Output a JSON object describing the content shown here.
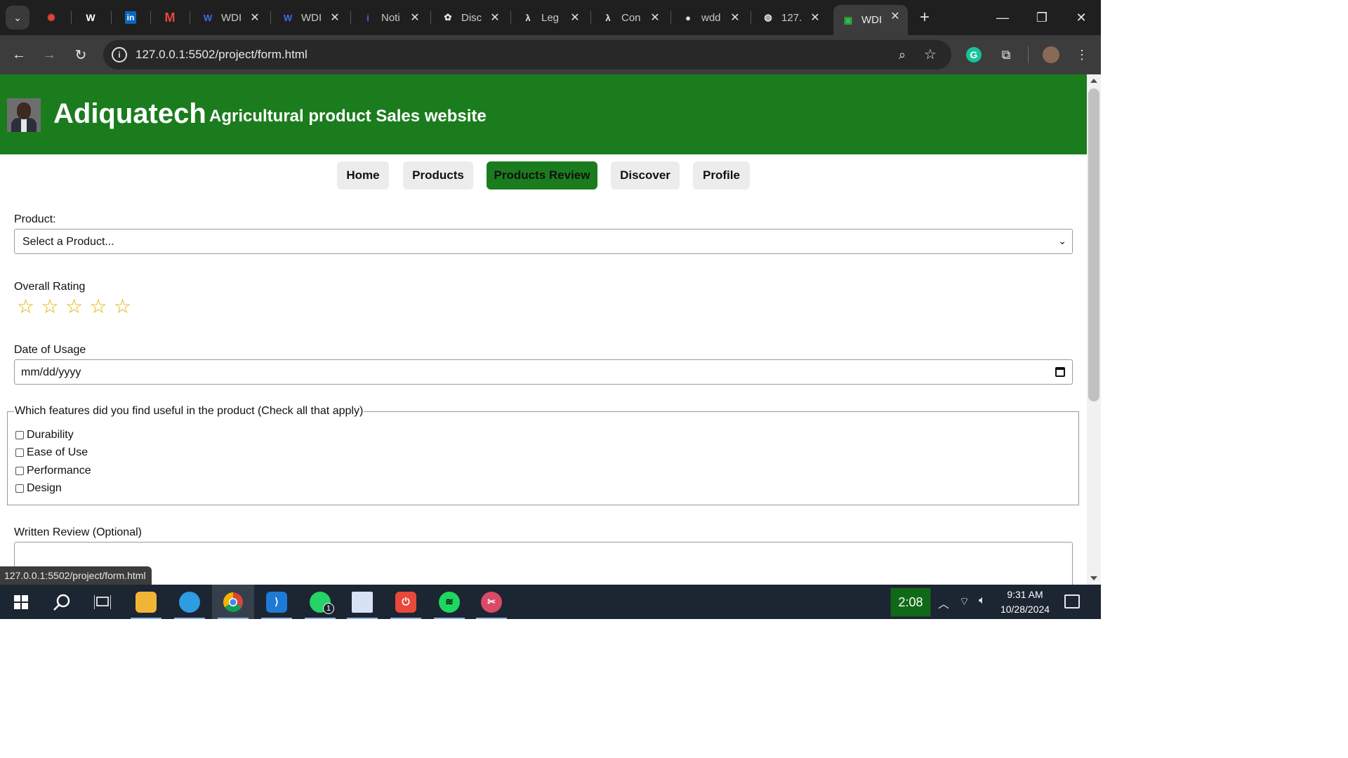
{
  "browser": {
    "tabs": [
      {
        "title": "WDI",
        "icon": "wordpress-icon",
        "color": "#3b6fe6"
      },
      {
        "title": "WDI",
        "icon": "wordpress-icon",
        "color": "#3b6fe6"
      },
      {
        "title": "Noti",
        "icon": "info-icon",
        "color": "#3b6fe6"
      },
      {
        "title": "Disc",
        "icon": "openai-icon",
        "color": "#e8e8e8"
      },
      {
        "title": "Leg",
        "icon": "lambda-icon",
        "color": "#e8e8e8"
      },
      {
        "title": "Con",
        "icon": "lambda-icon",
        "color": "#e8e8e8"
      },
      {
        "title": "wdd",
        "icon": "github-icon",
        "color": "#e8e8e8"
      },
      {
        "title": "127.",
        "icon": "globe-icon",
        "color": "#e8e8e8"
      },
      {
        "title": "WDI",
        "icon": "green-app-icon",
        "color": "#2fbf4a",
        "active": true
      }
    ],
    "url": "127.0.0.1:5502/project/form.html",
    "status_url": "127.0.0.1:5502/project/form.html"
  },
  "site": {
    "brand": "Adiquatech",
    "tagline": "Agricultural product Sales website",
    "nav": [
      {
        "label": "Home",
        "active": false
      },
      {
        "label": "Products",
        "active": false
      },
      {
        "label": "Products Review",
        "active": true
      },
      {
        "label": "Discover",
        "active": false
      },
      {
        "label": "Profile",
        "active": false
      }
    ],
    "accent_color": "#1b7c1e"
  },
  "form": {
    "product_label": "Product:",
    "product_value": "Select a Product...",
    "rating_label": "Overall Rating",
    "rating_max": 5,
    "rating_value": 0,
    "date_label": "Date of Usage",
    "date_placeholder": "mm/dd/yyyy",
    "features_legend": "Which features did you find useful in the product (Check all that apply)",
    "features": [
      {
        "label": "Durability",
        "checked": false
      },
      {
        "label": "Ease of Use",
        "checked": false
      },
      {
        "label": "Performance",
        "checked": false
      },
      {
        "label": "Design",
        "checked": false
      }
    ],
    "review_label": "Written Review (Optional)"
  },
  "taskbar": {
    "timer": "2:08",
    "time": "9:31 AM",
    "date": "10/28/2024",
    "whatsapp_badge": "1"
  }
}
